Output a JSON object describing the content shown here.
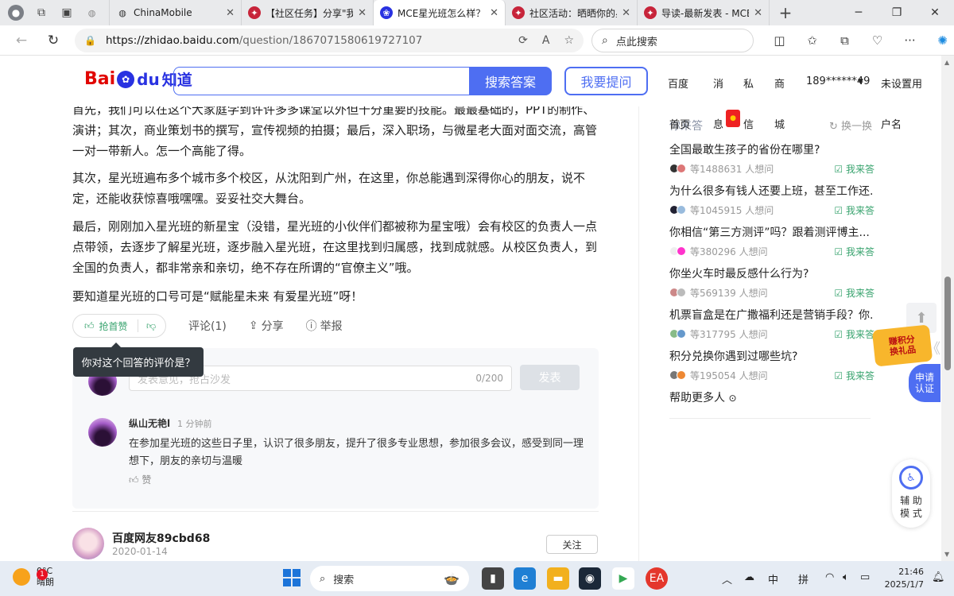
{
  "browser": {
    "tabs": [
      {
        "title": "ChinaMobile",
        "favicon": "globe-icon",
        "active": false
      },
      {
        "title": "【社区任务】分享\"我眼",
        "favicon": "mce-icon",
        "active": false
      },
      {
        "title": "MCE星光班怎么样？_百",
        "favicon": "baidu-paw-icon",
        "active": true
      },
      {
        "title": "社区活动：晒晒你的星",
        "favicon": "mce-icon",
        "active": false
      },
      {
        "title": "导读-最新发表 - MCE",
        "favicon": "mce-icon",
        "active": false
      }
    ],
    "new_tab": "+",
    "url_host": "https://zhidao.baidu.com",
    "url_path": "/question/1867071580619727107",
    "search_placeholder": "点此搜索"
  },
  "header": {
    "logo_bai": "Bai",
    "logo_du": "du",
    "logo_zhidao": "知道",
    "search_button": "搜索答案",
    "ask_button": "我要提问",
    "nav": [
      "百度",
      "消",
      "私",
      "商",
      "189******49",
      "未设置用"
    ],
    "overlay_nav": [
      "首页",
      "息",
      "信",
      "城",
      "户名"
    ]
  },
  "answer": {
    "paragraphs": [
      "首先，我们可以在这个大家庭学到许许多多课堂以外但十分重要的技能。最最基础的，PPT的制作、演讲；其次，商业策划书的撰写，宣传视频的拍摄；最后，深入职场，与微星老大面对面交流，高管一对一带新人。怎一个高能了得。",
      "其次，星光班遍布多个城市多个校区，从沈阳到广州，在这里，你总能遇到深得你心的朋友，说不定，还能收获惊喜哦嘿嘿。妥妥社交大舞台。",
      "最后，刚刚加入星光班的新星宝（没错，星光班的小伙伴们都被称为星宝哦）会有校区的负责人一点点带领，去逐步了解星光班，逐步融入星光班，在这里找到归属感，找到成就感。从校区负责人，到全国的负责人，都非常亲和亲切，绝不存在所谓的“官僚主义”哦。",
      "要知道星光班的口号可是“赋能星未来 有爱星光班”呀！"
    ],
    "like_label": "抢首赞",
    "comment_label": "评论(1)",
    "share_label": "分享",
    "report_label": "举报",
    "tooltip": "你对这个回答的评价是？"
  },
  "comments": {
    "input_placeholder": "发表意见，抢占沙发",
    "input_count": "0/200",
    "send_label": "发表",
    "items": [
      {
        "name": "纵山无艳l",
        "time": "1 分钟前",
        "text": "在参加星光班的这些日子里，认识了很多朋友，提升了很多专业思想，参加很多会议，感受到同一理想下，朋友的亲切与温暖",
        "like_label": "赞"
      }
    ]
  },
  "next_answer": {
    "name": "百度网友89cbd68",
    "date": "2020-01-14",
    "follow_label": "关注"
  },
  "sidebar": {
    "title": "你来答",
    "refresh_label": "换一换",
    "questions": [
      {
        "title": "全国最敢生孩子的省份在哪里?",
        "wait": "等1488631 人想问",
        "answer_label": "我来答"
      },
      {
        "title": "为什么很多有钱人还要上班，甚至工作还...",
        "wait": "等1045915 人想问",
        "answer_label": "我来答"
      },
      {
        "title": "你相信“第三方测评”吗？跟着测评博主...",
        "wait": "等380296 人想问",
        "answer_label": "我来答"
      },
      {
        "title": "你坐火车时最反感什么行为?",
        "wait": "等569139 人想问",
        "answer_label": "我来答"
      },
      {
        "title": "机票盲盒是在广撒福利还是营销手段？你...",
        "wait": "等317795 人想问",
        "answer_label": "我来答"
      },
      {
        "title": "积分兑换你遇到过哪些坑?",
        "wait": "等195054 人想问",
        "answer_label": "我来答"
      }
    ],
    "help_more": "帮助更多人"
  },
  "floats": {
    "gift": "赚积分\n换礼品",
    "apply": "申请\n认证",
    "assist": "辅 助\n模 式"
  },
  "taskbar": {
    "temp": "0°C",
    "weather": "晴朗",
    "weather_badge": "1",
    "search_label": "搜索",
    "ime1": "中",
    "ime2": "拼",
    "time": "21:46",
    "date": "2025/1/7"
  }
}
